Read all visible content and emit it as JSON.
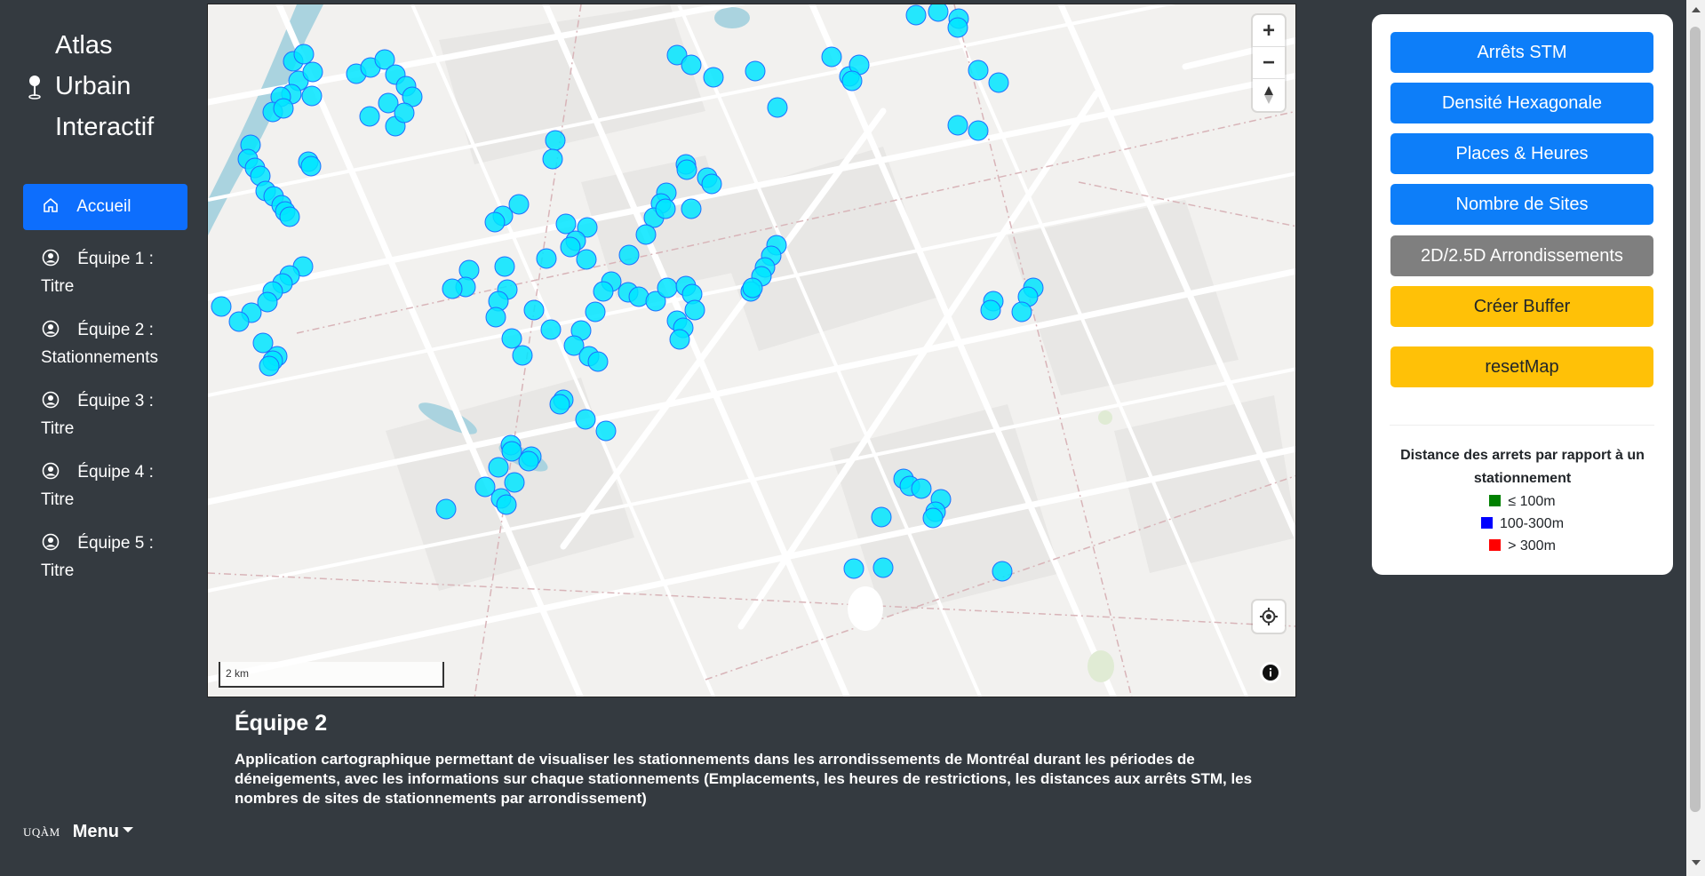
{
  "app": {
    "brand_title": "Atlas\nUrbain\nInteractif",
    "icon": "map-pin-icon"
  },
  "sidebar": {
    "items": [
      {
        "label": "Accueil",
        "icon": "home-icon",
        "active": true
      },
      {
        "label_line1": "Équipe 1 :",
        "label_line2": "Titre",
        "icon": "user-circle-icon"
      },
      {
        "label_line1": "Équipe 2 :",
        "label_line2": "Stationnements",
        "icon": "user-circle-icon"
      },
      {
        "label_line1": "Équipe 3 :",
        "label_line2": "Titre",
        "icon": "user-circle-icon"
      },
      {
        "label_line1": "Équipe 4 :",
        "label_line2": "Titre",
        "icon": "user-circle-icon"
      },
      {
        "label_line1": "Équipe 5 :",
        "label_line2": "Titre",
        "icon": "user-circle-icon"
      }
    ],
    "footer": {
      "logo_text": "UQÀM",
      "menu_label": "Menu"
    }
  },
  "map": {
    "zoom_in": "+",
    "zoom_out": "−",
    "scale_label": "2 km",
    "marker_color": "#00e5ff",
    "background_color": "#f2f1ef"
  },
  "panel": {
    "buttons": [
      {
        "label": "Arrêts STM",
        "style": "blue"
      },
      {
        "label": "Densité Hexagonale",
        "style": "blue"
      },
      {
        "label": "Places & Heures",
        "style": "blue"
      },
      {
        "label": "Nombre de Sites",
        "style": "blue"
      },
      {
        "label": "2D/2.5D Arrondissements",
        "style": "gray"
      },
      {
        "label": "Créer Buffer",
        "style": "yellow"
      },
      {
        "label": "resetMap",
        "style": "yellow"
      }
    ],
    "legend": {
      "title": "Distance des arrets par rapport à un stationnement",
      "items": [
        {
          "label": "≤ 100m",
          "color": "#008000"
        },
        {
          "label": "100-300m",
          "color": "#0000ff"
        },
        {
          "label": "> 300m",
          "color": "#ff0000"
        }
      ]
    }
  },
  "description": {
    "title": "Équipe 2",
    "text": "Application cartographique permettant de visualiser les stationnements dans les arrondissements de Montréal durant les périodes de déneigements, avec les informations sur chaque stationnements (Emplacements, les heures de restrictions, les distances aux arrêts STM, les nombres de sites de stationnements par arrondissement)"
  }
}
